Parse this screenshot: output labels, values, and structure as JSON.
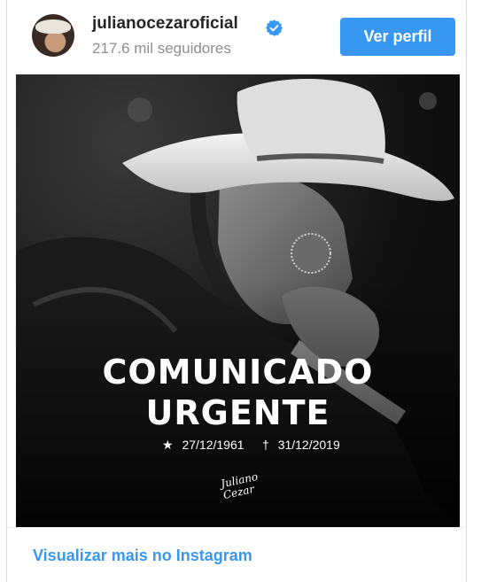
{
  "header": {
    "username": "julianocezaroficial",
    "followers": "217.6 mil seguidores",
    "view_profile_label": "Ver perfil"
  },
  "post": {
    "headline_line1": "COMUNICADO",
    "headline_line2": "URGENTE",
    "birth_date": "27/12/1961",
    "death_date": "31/12/2019",
    "signature": "Juliano Cezar"
  },
  "footer": {
    "view_more_label": "Visualizar mais no Instagram"
  },
  "colors": {
    "accent": "#3897f0",
    "verified_badge": "#3897f0",
    "text_primary": "#262626",
    "text_secondary": "#8e8e8e"
  }
}
